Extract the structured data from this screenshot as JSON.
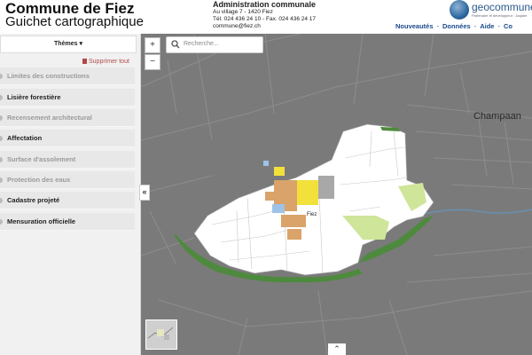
{
  "header": {
    "title": "Commune de Fiez",
    "subtitle": "Guichet cartographique",
    "admin_title": "Administration communale",
    "admin_address": "Au village 7 - 1420 Fiez",
    "admin_phone": "Tél. 024 436 24 10 - Fax. 024 436 24 17",
    "admin_email": "commune@fiez.ch",
    "logo_text": "geocommunes",
    "logo_tagline": "Partenaire et développeur : Jaquier",
    "nav": [
      "Nouveautés",
      "Données",
      "Aide",
      "Co"
    ]
  },
  "sidebar": {
    "themes_label": "Thèmes",
    "delete_all": "Supprimer tout",
    "items": [
      {
        "label": "Limites des constructions",
        "active": false
      },
      {
        "label": "Lisière forestière",
        "active": true
      },
      {
        "label": "Recensement architectural",
        "active": false
      },
      {
        "label": "Affectation",
        "active": true
      },
      {
        "label": "Surface d'assolement",
        "active": false
      },
      {
        "label": "Protection des eaux",
        "active": false
      },
      {
        "label": "Cadastre projeté",
        "active": true
      },
      {
        "label": "Mensuration officielle",
        "active": true
      }
    ],
    "collapse_label": "«"
  },
  "map": {
    "zoom_in": "+",
    "zoom_out": "−",
    "search_placeholder": "Recherche...",
    "place_champ": "Champaan",
    "place_fiez": "Fiez",
    "place_fiez_bottom": "Fiez",
    "expand_label": "»"
  },
  "colors": {
    "nav": "#1a4a8c",
    "map_bg": "#787878",
    "forest": "#4e8a3e",
    "zone_orange": "#d9a36a",
    "zone_yellow": "#f2e13a"
  }
}
